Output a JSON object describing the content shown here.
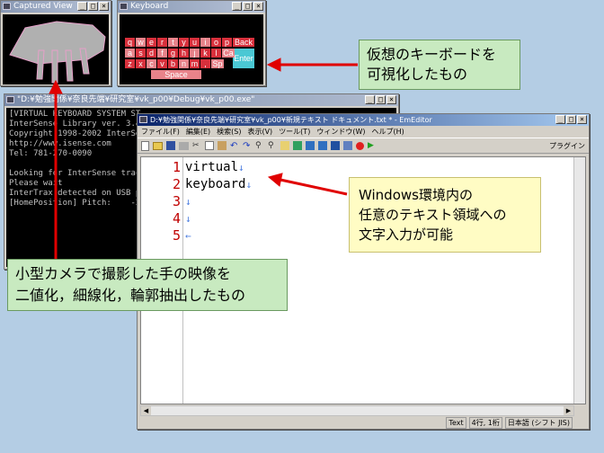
{
  "captured_window": {
    "title": "Captured View"
  },
  "keyboard_window": {
    "title": "Keyboard",
    "rows": [
      [
        "q",
        "w",
        "e",
        "r",
        "t",
        "y",
        "u",
        "i",
        "o",
        "p"
      ],
      [
        "a",
        "s",
        "d",
        "f",
        "g",
        "h",
        "j",
        "k",
        "l",
        "Ca"
      ],
      [
        "z",
        "x",
        "c",
        "v",
        "b",
        "n",
        "m",
        ",",
        "Sp"
      ]
    ],
    "back": "Back",
    "enter": "Enter",
    "space": "Space"
  },
  "console_window": {
    "title": "\"D:¥勉強関係¥奈良先端¥研究室¥vk_p00¥Debug¥vk_p00.exe\"",
    "lines": [
      "[VIRTUAL KEYBOARD SYSTEM ST",
      "InterSense Library ver. 3.4",
      "Copyright 1998-2002 InterSe",
      "http://www.isense.com",
      "Tel: 781-270-0090",
      "",
      "Looking for InterSense trac",
      "Please wait",
      "InterTrax detected on USB p",
      "[HomePosition] Pitch:    -2."
    ]
  },
  "editor": {
    "title": "D:¥勉強関係¥奈良先端¥研究室¥vk_p00¥新規テキスト ドキュメント.txt * - EmEditor",
    "menu": [
      "ファイル(F)",
      "編集(E)",
      "検索(S)",
      "表示(V)",
      "ツール(T)",
      "ウィンドウ(W)",
      "ヘルプ(H)"
    ],
    "plugins": "プラグイン",
    "line_numbers": [
      "1",
      "2",
      "3",
      "4",
      "5"
    ],
    "lines": [
      "virtual",
      "keyboard",
      "",
      "",
      ""
    ],
    "newline_mark": "↓",
    "eof_mark": "←",
    "status": {
      "encoding_text": "Text",
      "position": "4行, 1桁",
      "charset": "日本語 (シフト JIS)"
    }
  },
  "callouts": {
    "keyboard_note": [
      "仮想のキーボードを",
      "可視化したもの"
    ],
    "input_note": [
      "Windows環境内の",
      "任意のテキスト領域への",
      "文字入力が可能"
    ],
    "camera_note": [
      "小型カメラで撮影した手の映像を",
      "二値化，細線化，輪郭抽出したもの"
    ]
  },
  "colors": {
    "accent_red": "#e00000",
    "callout_green": "#c8eac0",
    "callout_yellow": "#fffcc4",
    "key_red": "#d8303c"
  }
}
